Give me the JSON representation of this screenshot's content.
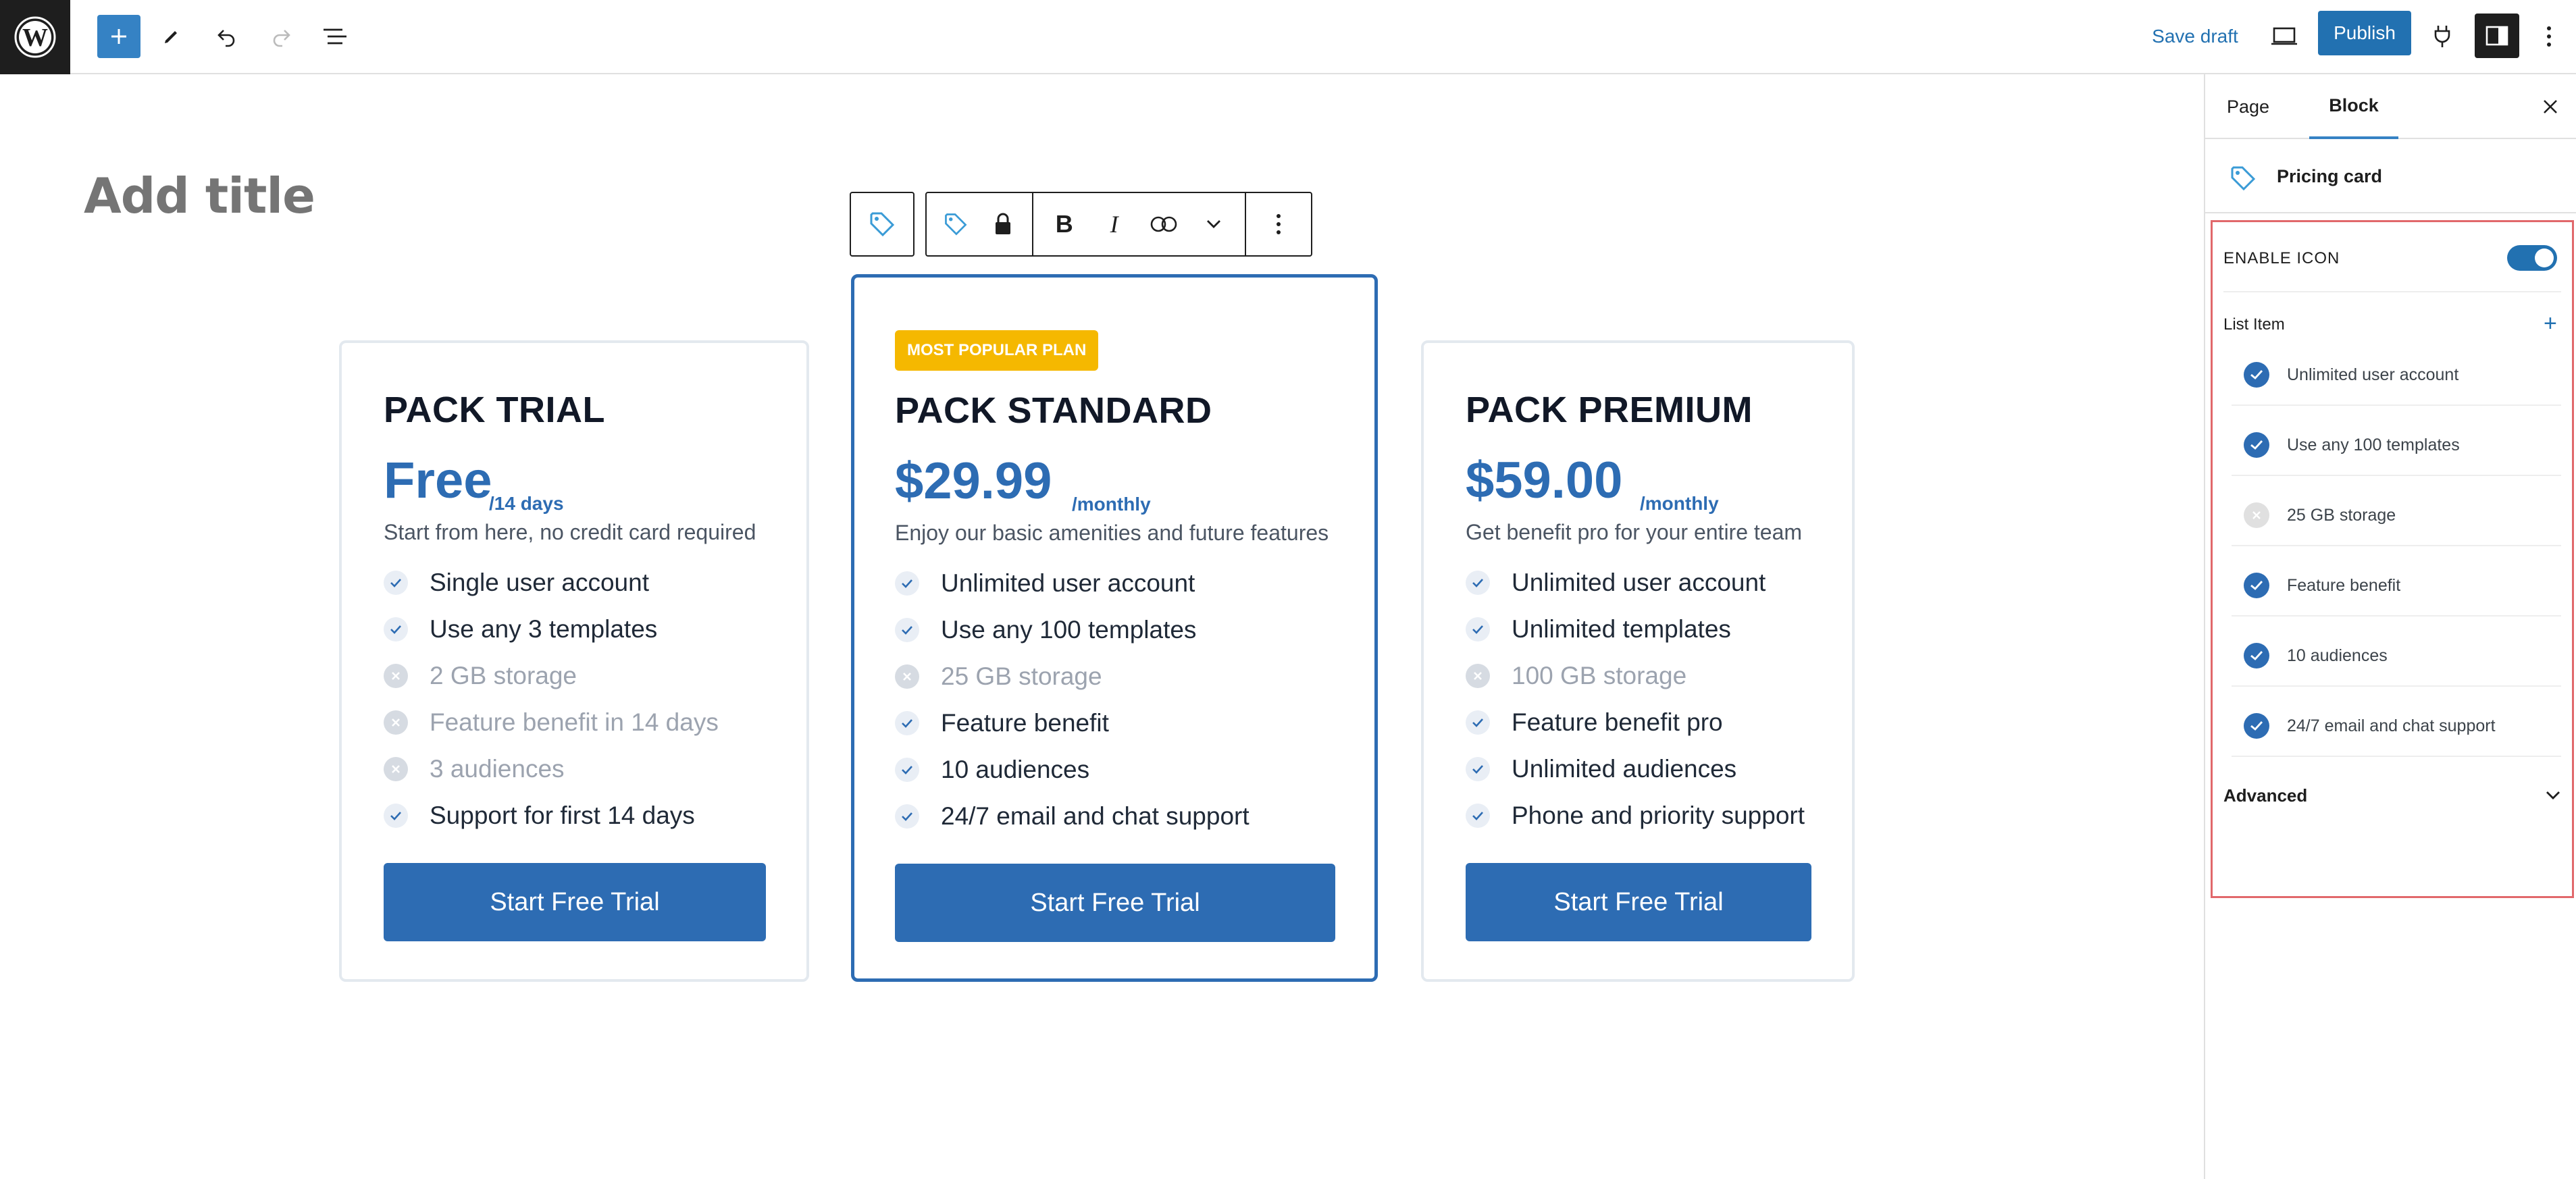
{
  "topbar": {
    "save_draft": "Save draft",
    "publish": "Publish"
  },
  "editor": {
    "title_placeholder": "Add title"
  },
  "cards": [
    {
      "name": "PACK TRIAL",
      "price": "Free",
      "period": "/14 days",
      "description": "Start from here, no credit card required",
      "features": [
        {
          "label": "Single user account",
          "enabled": true
        },
        {
          "label": "Use any 3 templates",
          "enabled": true
        },
        {
          "label": "2 GB storage",
          "enabled": false
        },
        {
          "label": "Feature benefit in 14 days",
          "enabled": false
        },
        {
          "label": "3 audiences",
          "enabled": false
        },
        {
          "label": "Support for first 14 days",
          "enabled": true
        }
      ],
      "cta": "Start Free Trial"
    },
    {
      "badge": "MOST POPULAR PLAN",
      "name": "PACK STANDARD",
      "price": "$29.99",
      "period": "/monthly",
      "description": "Enjoy our basic amenities and future features",
      "features": [
        {
          "label": "Unlimited user account",
          "enabled": true
        },
        {
          "label": "Use any 100 templates",
          "enabled": true
        },
        {
          "label": "25 GB storage",
          "enabled": false
        },
        {
          "label": "Feature benefit",
          "enabled": true
        },
        {
          "label": "10 audiences",
          "enabled": true
        },
        {
          "label": "24/7 email and chat support",
          "enabled": true
        }
      ],
      "cta": "Start Free Trial"
    },
    {
      "name": "PACK PREMIUM",
      "price": "$59.00",
      "period": "/monthly",
      "description": "Get benefit pro for your entire team",
      "features": [
        {
          "label": "Unlimited user account",
          "enabled": true
        },
        {
          "label": "Unlimited templates",
          "enabled": true
        },
        {
          "label": "100 GB storage",
          "enabled": false
        },
        {
          "label": "Feature benefit pro",
          "enabled": true
        },
        {
          "label": "Unlimited audiences",
          "enabled": true
        },
        {
          "label": "Phone and priority support",
          "enabled": true
        }
      ],
      "cta": "Start Free Trial"
    }
  ],
  "sidebar": {
    "tabs": [
      "Page",
      "Block"
    ],
    "active_tab": "Block",
    "block_title": "Pricing card",
    "enable_icon_label": "ENABLE ICON",
    "enable_icon_on": true,
    "list_item_label": "List Item",
    "list_items": [
      {
        "label": "Unlimited user account",
        "enabled": true
      },
      {
        "label": "Use any 100 templates",
        "enabled": true
      },
      {
        "label": "25 GB storage",
        "enabled": false
      },
      {
        "label": "Feature benefit",
        "enabled": true
      },
      {
        "label": "10 audiences",
        "enabled": true
      },
      {
        "label": "24/7 email and chat support",
        "enabled": true
      }
    ],
    "advanced_label": "Advanced"
  },
  "colors": {
    "accent": "#2271b1",
    "card_blue": "#2d6cb3",
    "badge": "#f5b800",
    "highlight_border": "#e1686b"
  }
}
